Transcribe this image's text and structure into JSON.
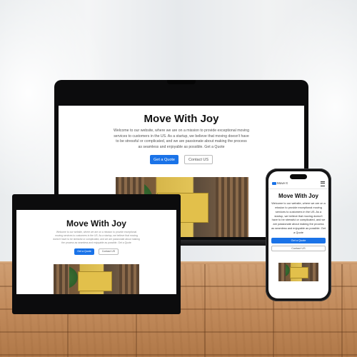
{
  "site": {
    "brand": "Move It",
    "title": "Move With Joy",
    "description": "Welcome to our website, where we are on a mission to provide exceptional moving services to customers in the US. As a startup, we believe that moving doesn't have to be stressful or complicated, and we are passionate about making the process as seamless and enjoyable as possible. Get a Quote",
    "primary_button": "Get a Quote",
    "secondary_button": "Contact US"
  },
  "colors": {
    "accent": "#1a73e8",
    "frame": "#0c0c0d",
    "floor": "#c18a5b"
  },
  "icons": {
    "menu": "hamburger-menu-icon",
    "brand": "logo-icon"
  }
}
